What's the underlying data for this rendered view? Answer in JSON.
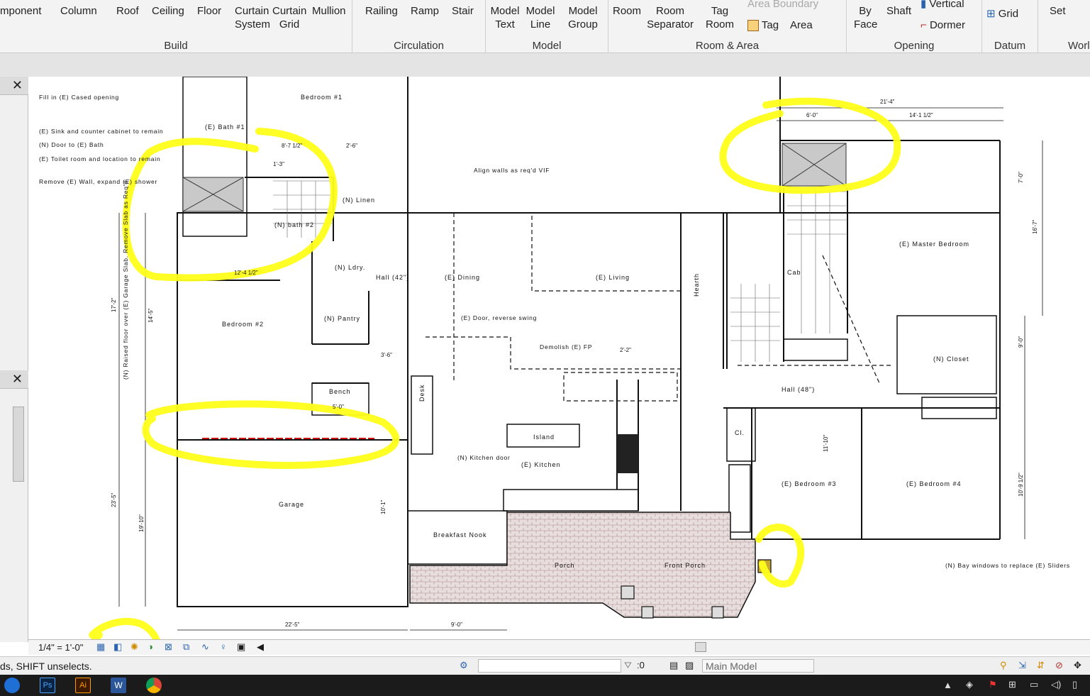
{
  "ribbon": {
    "build": {
      "title": "Build",
      "tools": [
        "mponent",
        "Column",
        "Roof",
        "Ceiling",
        "Floor",
        "Curtain System",
        "Curtain Grid",
        "Mullion"
      ]
    },
    "circulation": {
      "title": "Circulation",
      "tools": [
        "Railing",
        "Ramp",
        "Stair"
      ]
    },
    "model": {
      "title": "Model",
      "tools": [
        "Model Text",
        "Model Line",
        "Model Group"
      ]
    },
    "room_area": {
      "title": "Room & Area",
      "tools": [
        "Room",
        "Room Separator",
        "Tag Room",
        "Area Boundary",
        "Tag",
        "Area"
      ]
    },
    "opening": {
      "title": "Opening",
      "tools": [
        "By Face",
        "Shaft",
        "Vertical",
        "Dormer"
      ]
    },
    "datum": {
      "title": "Datum",
      "tools": [
        "Grid"
      ]
    },
    "work": {
      "title": "Worl",
      "tools": [
        "Set"
      ]
    }
  },
  "plan": {
    "rooms": [
      "Bedroom #1",
      "Bedroom #2",
      "(E) Bath #1",
      "(N) bath #2",
      "(N) Linen",
      "(N) Ldry.",
      "(N) Pantry",
      "Hall (42\")",
      "(E) Dining",
      "(E) Living",
      "Garage",
      "Bench",
      "Desk",
      "Island",
      "(E) Kitchen",
      "Breakfast Nook",
      "Porch",
      "Front Porch",
      "(E) Master Bedroom",
      "Cab",
      "Cl.",
      "(N) Closet",
      "(E) Bedroom #3",
      "(E) Bedroom #4",
      "Hall (48\")",
      "Hearth"
    ],
    "notes": [
      "Fill in (E) Cased opening",
      "(E) Sink and counter cabinet to remain",
      "(N) Door to (E) Bath",
      "(E) Toilet room and location to remain",
      "Remove (E) Wall, expand (E) shower",
      "Align walls as req'd VIF",
      "(E) Door, reverse swing",
      "Demolish (E) FP",
      "(N) Kitchen door",
      "(N) Bay windows to replace (E) Sliders",
      "(N) Raised floor over (E) Garage Slab. Remove Slab as Req'd"
    ],
    "dims": [
      "21'-4\"",
      "6'-0\"",
      "14'-1 1/2\"",
      "8'-7 1/2\"",
      "2'-6\"",
      "1'-3\"",
      "12'-4 1/2\"",
      "17'-2\"",
      "14'-5\"",
      "22'-5\"",
      "9'-0\"",
      "19'-10\"",
      "23'-5\"",
      "10'-1\"",
      "3'-6\"",
      "2'-2\"",
      "5'-0\"",
      "16'-7\"",
      "7'-0\"",
      "9'-0\"",
      "10'-9 1/2\"",
      "11'-10\""
    ]
  },
  "view_controls": {
    "scale": "1/4\" = 1'-0\""
  },
  "status": {
    "text": "ds, SHIFT unselects.",
    "filter_value": ":0",
    "model": "Main Model"
  },
  "taskbar": {
    "apps": [
      "Photoshop",
      "Illustrator",
      "Word",
      "Chrome"
    ]
  },
  "colors": {
    "highlight": "#ffff1a",
    "ribbon_bg": "#f3f3f3",
    "taskbar": "#1b1b1b"
  }
}
